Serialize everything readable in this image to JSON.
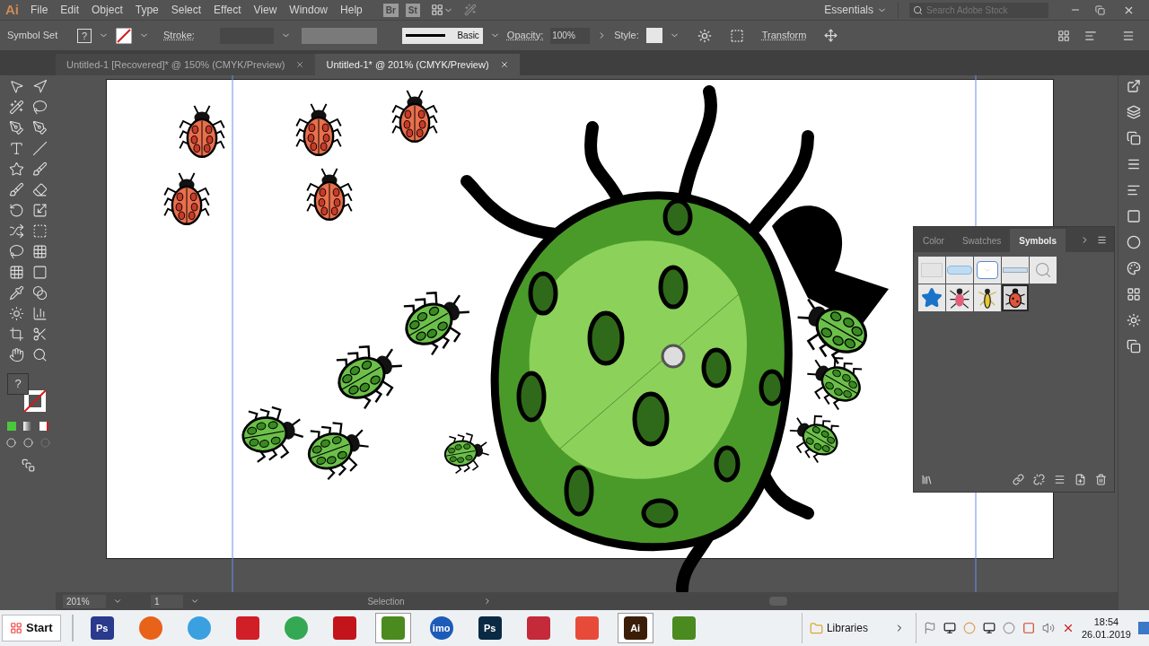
{
  "app": {
    "logo": "Ai",
    "menu": [
      "File",
      "Edit",
      "Object",
      "Type",
      "Select",
      "Effect",
      "View",
      "Window",
      "Help"
    ],
    "bridge_buttons": [
      "Br",
      "St"
    ],
    "workspace": "Essentials",
    "search": {
      "placeholder": "Search Adobe Stock"
    }
  },
  "control_bar": {
    "selection_label": "Symbol Set",
    "fill_label": "?",
    "stroke_label": "Stroke:",
    "brush_label": "Basic",
    "opacity_label": "Opacity:",
    "opacity_value": "100%",
    "style_label": "Style:",
    "transform_label": "Transform"
  },
  "tabs": [
    {
      "label": "Untitled-1 [Recovered]* @ 150% (CMYK/Preview)",
      "selected": false
    },
    {
      "label": "Untitled-1* @ 201% (CMYK/Preview)",
      "selected": true
    }
  ],
  "toolbar": {
    "fill_label": "?"
  },
  "symbols_panel": {
    "tabs": [
      {
        "label": "Color",
        "selected": false
      },
      {
        "label": "Swatches",
        "selected": false
      },
      {
        "label": "Symbols",
        "selected": true
      }
    ],
    "symbols": [
      {
        "kind": "box",
        "selected": false
      },
      {
        "kind": "bar",
        "selected": false
      },
      {
        "kind": "dropdown",
        "selected": false
      },
      {
        "kind": "line",
        "selected": false
      },
      {
        "kind": "magnifier",
        "selected": false
      },
      {
        "kind": "star",
        "selected": false
      },
      {
        "kind": "spider",
        "selected": false
      },
      {
        "kind": "wasp",
        "selected": false
      },
      {
        "kind": "ladybug",
        "selected": true
      }
    ]
  },
  "status_bar": {
    "zoom": "201%",
    "artboard": "1",
    "tool": "Selection"
  },
  "taskbar": {
    "start": "Start",
    "apps": [
      {
        "kind": "square",
        "label": "Ps",
        "color": "#2a3a8c",
        "selected": false
      },
      {
        "kind": "circle",
        "color": "#e8621a",
        "selected": false
      },
      {
        "kind": "circle",
        "color": "#3aa0e0",
        "selected": false
      },
      {
        "kind": "square",
        "color": "#d01f27",
        "selected": false
      },
      {
        "kind": "circle",
        "color": "#34a853",
        "selected": false
      },
      {
        "kind": "square",
        "color": "#c4141b",
        "selected": false
      },
      {
        "kind": "square",
        "color": "#4a8a1e",
        "selected": true
      },
      {
        "kind": "circle",
        "label": "imo",
        "color": "#1c5bb8",
        "selected": false
      },
      {
        "kind": "square",
        "label": "Ps",
        "color": "#0a2a44",
        "selected": false
      },
      {
        "kind": "square",
        "color": "#c42a3a",
        "selected": false
      },
      {
        "kind": "square",
        "color": "#e84a3a",
        "selected": false
      },
      {
        "kind": "square",
        "label": "Ai",
        "color": "#3a1e08",
        "selected": true
      },
      {
        "kind": "square",
        "color": "#4a8a1e",
        "selected": false
      }
    ],
    "libraries": "Libraries",
    "time": "18:54",
    "date": "26.01.2019"
  }
}
